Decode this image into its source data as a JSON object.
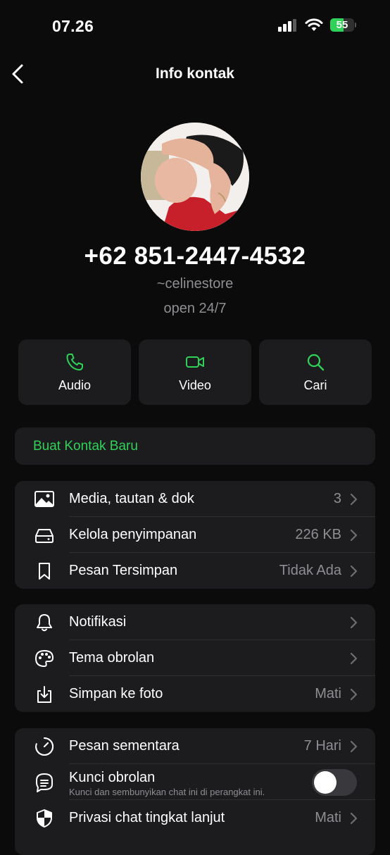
{
  "status": {
    "time": "07.26",
    "battery": "55",
    "battery_level": 0.55
  },
  "nav": {
    "title": "Info kontak"
  },
  "profile": {
    "phone": "+62 851-2447-4532",
    "username": "~celinestore",
    "about": "open 24/7"
  },
  "actions": [
    {
      "label": "Audio",
      "icon": "phone-icon"
    },
    {
      "label": "Video",
      "icon": "video-icon"
    },
    {
      "label": "Cari",
      "icon": "search-icon"
    }
  ],
  "create_contact": {
    "label": "Buat Kontak Baru"
  },
  "group1": [
    {
      "label": "Media, tautan & dok",
      "value": "3",
      "icon": "image-icon"
    },
    {
      "label": "Kelola penyimpanan",
      "value": "226 KB",
      "icon": "storage-icon"
    },
    {
      "label": "Pesan Tersimpan",
      "value": "Tidak Ada",
      "icon": "bookmark-icon"
    }
  ],
  "group2": [
    {
      "label": "Notifikasi",
      "value": "",
      "icon": "bell-icon"
    },
    {
      "label": "Tema obrolan",
      "value": "",
      "icon": "palette-icon"
    },
    {
      "label": "Simpan ke foto",
      "value": "Mati",
      "icon": "download-icon"
    }
  ],
  "group3": [
    {
      "label": "Pesan sementara",
      "value": "7 Hari",
      "icon": "timer-icon"
    },
    {
      "label": "Kunci obrolan",
      "sublabel": "Kunci dan sembunyikan chat ini di perangkat ini.",
      "toggle": false,
      "icon": "chat-lock-icon"
    },
    {
      "label": "Privasi chat tingkat lanjut",
      "value": "Mati",
      "icon": "shield-icon"
    }
  ],
  "colors": {
    "accent": "#30d158",
    "background": "#0b0b0b",
    "card": "#1c1c1e",
    "secondary_text": "#8e8e93"
  }
}
